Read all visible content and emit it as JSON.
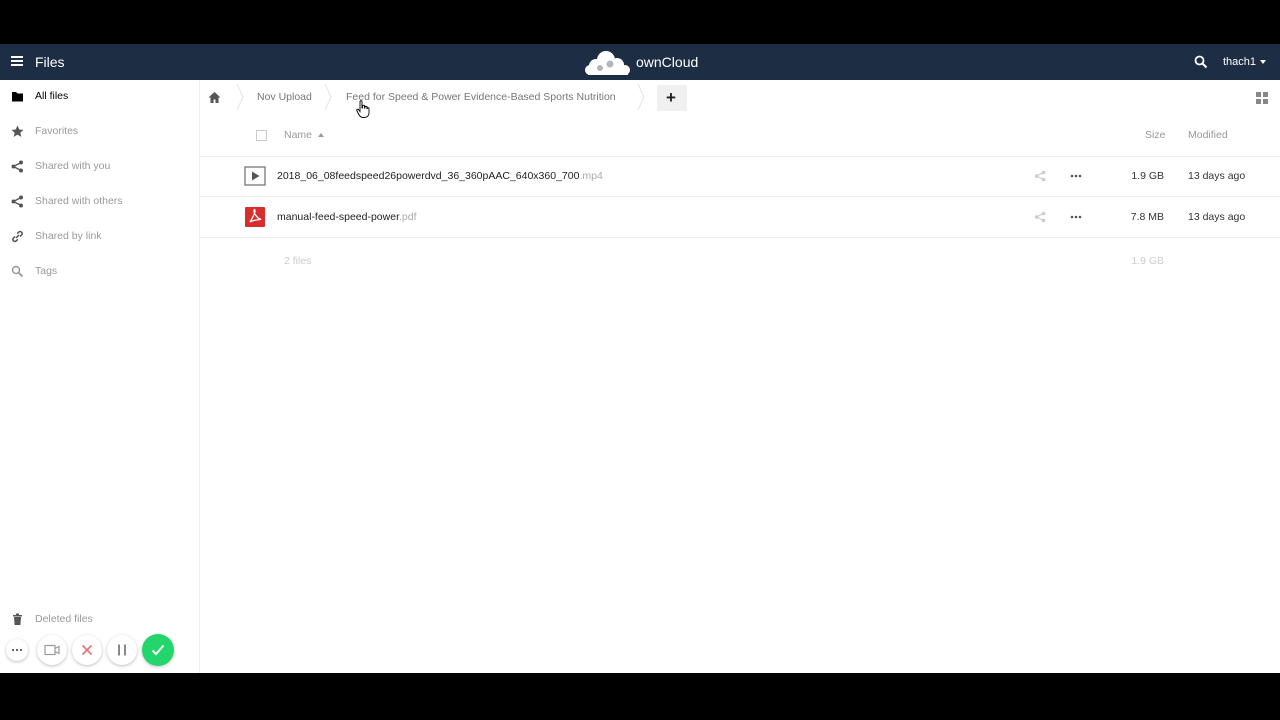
{
  "topbar": {
    "app_name": "Files",
    "logo_text": "ownCloud",
    "user": "thach1"
  },
  "sidebar": {
    "items": [
      {
        "label": "All files",
        "icon": "folder-icon",
        "active": true
      },
      {
        "label": "Favorites",
        "icon": "star-icon"
      },
      {
        "label": "Shared with you",
        "icon": "share-icon"
      },
      {
        "label": "Shared with others",
        "icon": "share-icon"
      },
      {
        "label": "Shared by link",
        "icon": "link-icon"
      },
      {
        "label": "Tags",
        "icon": "search-icon"
      }
    ],
    "deleted_files": "Deleted files"
  },
  "breadcrumbs": {
    "items": [
      "Nov Upload",
      "Feed for Speed & Power Evidence-Based Sports Nutrition"
    ],
    "add_label": "+"
  },
  "file_list": {
    "headers": {
      "name": "Name",
      "size": "Size",
      "modified": "Modified"
    },
    "rows": [
      {
        "base": "2018_06_08feedspeed26powerdvd_36_360pAAC_640x360_700",
        "ext": ".mp4",
        "size": "1.9 GB",
        "modified": "13 days ago",
        "icon": "video-file-icon"
      },
      {
        "base": "manual-feed-speed-power",
        "ext": ".pdf",
        "size": "7.8 MB",
        "modified": "13 days ago",
        "icon": "pdf-file-icon"
      }
    ],
    "summary": {
      "count": "2 files",
      "total": "1.9 GB"
    }
  },
  "colors": {
    "header_bg": "#1d2d44",
    "confirm_green": "#22d66b",
    "pdf_red": "#d72d2d"
  }
}
